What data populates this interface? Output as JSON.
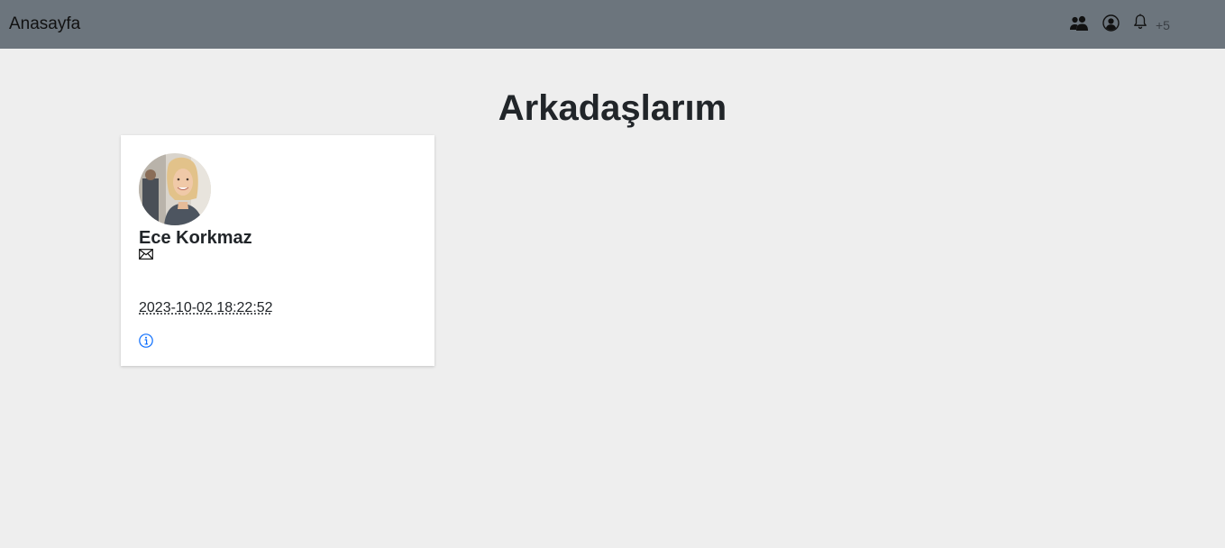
{
  "navbar": {
    "brand": "Anasayfa",
    "icons": {
      "friends": "friends-icon",
      "profile": "user-circle-icon",
      "notifications": "bell-icon"
    },
    "notification_count": "+5",
    "background": "#6c757d"
  },
  "main": {
    "title": "Arkadaşlarım",
    "friends": [
      {
        "name": "Ece Korkmaz",
        "date": "2023-10-02 18:22:52",
        "icons": {
          "message": "envelope-icon",
          "details": "info-circle-icon"
        }
      }
    ]
  },
  "colors": {
    "page_background": "#eeeeee",
    "card_background": "#ffffff",
    "accent": "#0d6efd"
  }
}
